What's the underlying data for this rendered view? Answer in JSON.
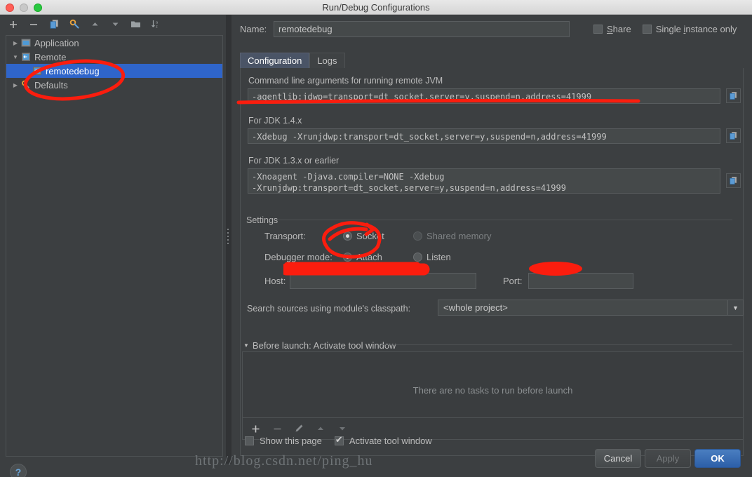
{
  "window": {
    "title": "Run/Debug Configurations",
    "traffic_lights": [
      "close-red",
      "minimize-gray",
      "zoom-green"
    ]
  },
  "sidebar": {
    "toolbar": [
      {
        "name": "add-configuration-button",
        "glyph": "+"
      },
      {
        "name": "remove-configuration-button",
        "glyph": "−"
      },
      {
        "name": "copy-configuration-button",
        "glyph": "copy-icon"
      },
      {
        "name": "edit-templates-button",
        "glyph": "wrench-icon"
      },
      {
        "name": "move-up-button",
        "glyph": "▲"
      },
      {
        "name": "move-down-button",
        "glyph": "▼"
      },
      {
        "name": "folder-button",
        "glyph": "folder-icon"
      },
      {
        "name": "sort-alphabetically-button",
        "glyph": "sort-az-icon"
      }
    ],
    "tree": [
      {
        "label": "Application",
        "level": 0,
        "expanded": false,
        "selected": false,
        "icon": "application-icon"
      },
      {
        "label": "Remote",
        "level": 0,
        "expanded": true,
        "selected": false,
        "icon": "remote-icon"
      },
      {
        "label": "remotedebug",
        "level": 1,
        "expanded": null,
        "selected": true,
        "icon": "remote-icon"
      },
      {
        "label": "Defaults",
        "level": 0,
        "expanded": false,
        "selected": false,
        "icon": "defaults-icon"
      }
    ],
    "help_label": "?"
  },
  "header": {
    "name_label": "Name:",
    "name_value": "remotedebug",
    "share_label": "Share",
    "share_checked": false,
    "single_instance_label": "Single instance only",
    "single_instance_checked": false
  },
  "tabs": [
    {
      "label": "Configuration",
      "active": true
    },
    {
      "label": "Logs",
      "active": false
    }
  ],
  "configuration": {
    "cmdline_label": "Command line arguments for running remote JVM",
    "cmdline_value": "-agentlib:jdwp=transport=dt_socket,server=y,suspend=n,address=41999",
    "jdk14_label": "For JDK 1.4.x",
    "jdk14_value": "-Xdebug -Xrunjdwp:transport=dt_socket,server=y,suspend=n,address=41999",
    "jdk13_label": "For JDK 1.3.x or earlier",
    "jdk13_value": "-Xnoagent -Djava.compiler=NONE -Xdebug\n-Xrunjdwp:transport=dt_socket,server=y,suspend=n,address=41999",
    "copy_icon_name": "copy-to-clipboard-icon",
    "settings": {
      "group_title": "Settings",
      "transport_label": "Transport:",
      "transport_options": [
        {
          "label": "Socket",
          "selected": true,
          "disabled": false
        },
        {
          "label": "Shared memory",
          "selected": false,
          "disabled": true
        }
      ],
      "debugger_mode_label": "Debugger mode:",
      "debugger_mode_options": [
        {
          "label": "Attach",
          "selected": true,
          "disabled": false
        },
        {
          "label": "Listen",
          "selected": false,
          "disabled": false
        }
      ],
      "host_label": "Host:",
      "host_value": "",
      "port_label": "Port:",
      "port_value": ""
    },
    "classpath_label": "Search sources using module's classpath:",
    "classpath_value": "<whole project>"
  },
  "before_launch": {
    "title": "Before launch: Activate tool window",
    "empty_text": "There are no tasks to run before launch",
    "toolbar": [
      {
        "name": "add-task-button",
        "glyph": "+",
        "enabled": true
      },
      {
        "name": "remove-task-button",
        "glyph": "−",
        "enabled": false
      },
      {
        "name": "edit-task-button",
        "glyph": "pencil-icon",
        "enabled": false
      },
      {
        "name": "move-task-up-button",
        "glyph": "▲",
        "enabled": false
      },
      {
        "name": "move-task-down-button",
        "glyph": "▼",
        "enabled": false
      }
    ],
    "show_page_label": "Show this page",
    "show_page_checked": false,
    "activate_tool_window_label": "Activate tool window",
    "activate_tool_window_checked": true
  },
  "footer": {
    "cancel_label": "Cancel",
    "apply_label": "Apply",
    "apply_enabled": false,
    "ok_label": "OK"
  },
  "watermark": "http://blog.csdn.net/ping_hu",
  "colors": {
    "accent_selection": "#2f65ca",
    "panel_bg": "#3c3f41",
    "field_bg": "#45494a",
    "marker_red": "#fb1d0e",
    "ok_button": "#2c5fa8"
  }
}
